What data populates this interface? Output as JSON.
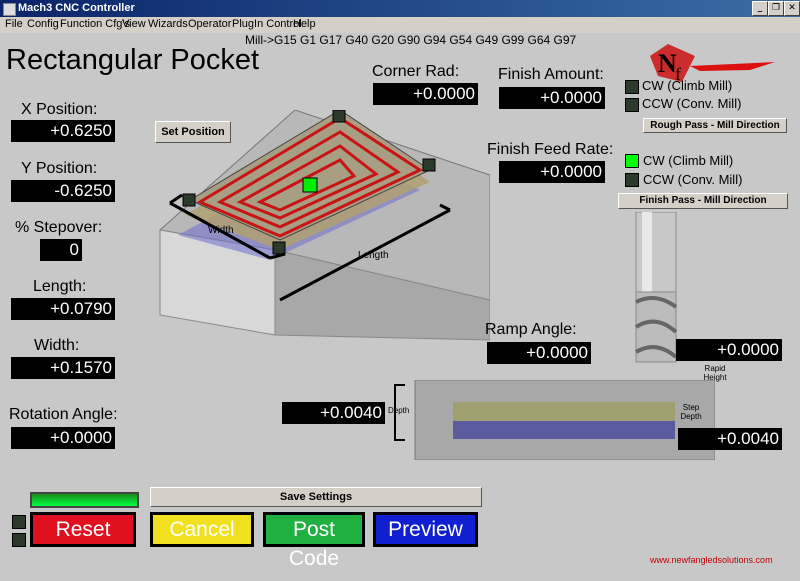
{
  "window": {
    "title": "Mach3 CNC Controller"
  },
  "menu": [
    "File",
    "Config",
    "Function Cfg's",
    "View",
    "Wizards",
    "Operator",
    "PlugIn Control",
    "Help"
  ],
  "gcode_line": "Mill->G15  G1 G17 G40 G20 G90 G94 G54 G49 G99 G64 G97",
  "page_title": "Rectangular Pocket",
  "fields": {
    "x_position": {
      "label": "X Position:",
      "value": "+0.6250"
    },
    "y_position": {
      "label": "Y Position:",
      "value": "-0.6250"
    },
    "stepover": {
      "label": "% Stepover:",
      "value": "0"
    },
    "length": {
      "label": "Length:",
      "value": "+0.0790"
    },
    "width": {
      "label": "Width:",
      "value": "+0.1570"
    },
    "rotation_angle": {
      "label": "Rotation Angle:",
      "value": "+0.0000"
    },
    "corner_rad": {
      "label": "Corner Rad:",
      "value": "+0.0000"
    },
    "finish_amount": {
      "label": "Finish Amount:",
      "value": "+0.0000"
    },
    "finish_feed_rate": {
      "label": "Finish Feed Rate:",
      "value": "+0.0000"
    },
    "ramp_angle": {
      "label": "Ramp Angle:",
      "value": "+0.0000"
    },
    "rapid_height": {
      "value": "+0.0000"
    },
    "depth": {
      "value": "+0.0040"
    },
    "step_depth": {
      "value": "+0.0040"
    }
  },
  "set_position": "Set Position",
  "rough": {
    "cw": "CW (Climb Mill)",
    "ccw": "CCW (Conv. Mill)",
    "button": "Rough Pass - Mill Direction"
  },
  "finish": {
    "cw": "CW (Climb Mill)",
    "ccw": "CCW (Conv. Mill)",
    "button": "Finish Pass - Mill Direction"
  },
  "diagram_labels": {
    "width": "Width",
    "length": "Length",
    "depth": "Depth",
    "rapid_height": "Rapid Height",
    "step_depth": "Step Depth"
  },
  "buttons": {
    "save": "Save Settings",
    "reset": "Reset",
    "cancel": "Cancel",
    "post": "Post Code",
    "preview": "Preview"
  },
  "website": "www.newfangledsolutions.com",
  "colors": {
    "reset": "#e01020",
    "cancel": "#f0e020",
    "post": "#20b040",
    "preview": "#1020d0",
    "led_on": "#00ff00"
  }
}
